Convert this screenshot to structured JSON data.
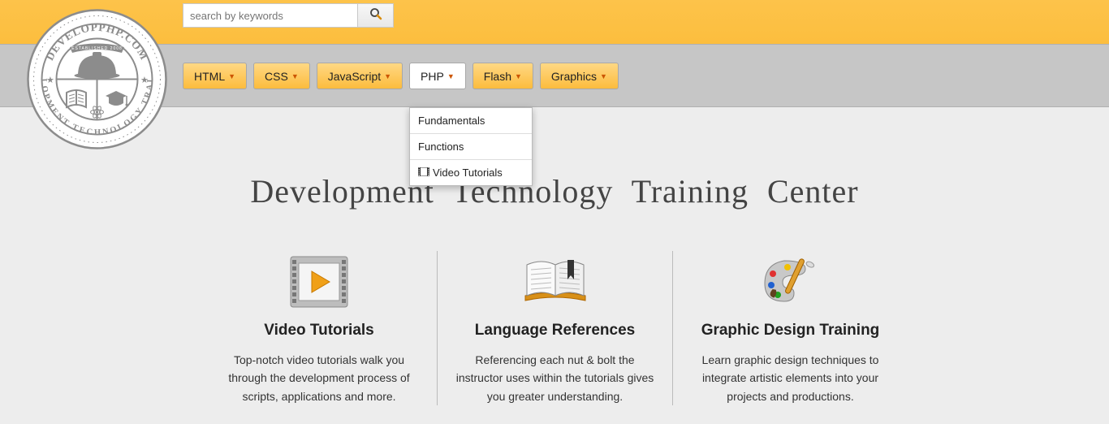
{
  "search": {
    "placeholder": "search by keywords"
  },
  "nav": {
    "items": [
      {
        "label": "HTML"
      },
      {
        "label": "CSS"
      },
      {
        "label": "JavaScript"
      },
      {
        "label": "PHP"
      },
      {
        "label": "Flash"
      },
      {
        "label": "Graphics"
      }
    ],
    "dropdown": {
      "items": [
        {
          "label": "Fundamentals"
        },
        {
          "label": "Functions"
        },
        {
          "label": "Video Tutorials"
        }
      ]
    }
  },
  "logo": {
    "top_text": "DEVELOPPHP.COM",
    "established": "ESTABLISHED",
    "year": "2008",
    "bottom_text": "DEVELOPMENT  TECHNOLOGY  TRAINING"
  },
  "hero": {
    "title": "Development  Technology  Training  Center"
  },
  "columns": [
    {
      "title": "Video Tutorials",
      "body": "Top-notch video tutorials walk you through the development process of scripts, applications and more."
    },
    {
      "title": "Language References",
      "body": "Referencing each nut & bolt the instructor uses within the tutorials gives you greater understanding."
    },
    {
      "title": "Graphic Design Training",
      "body": "Learn graphic design techniques to integrate artistic elements into your projects and productions."
    }
  ]
}
